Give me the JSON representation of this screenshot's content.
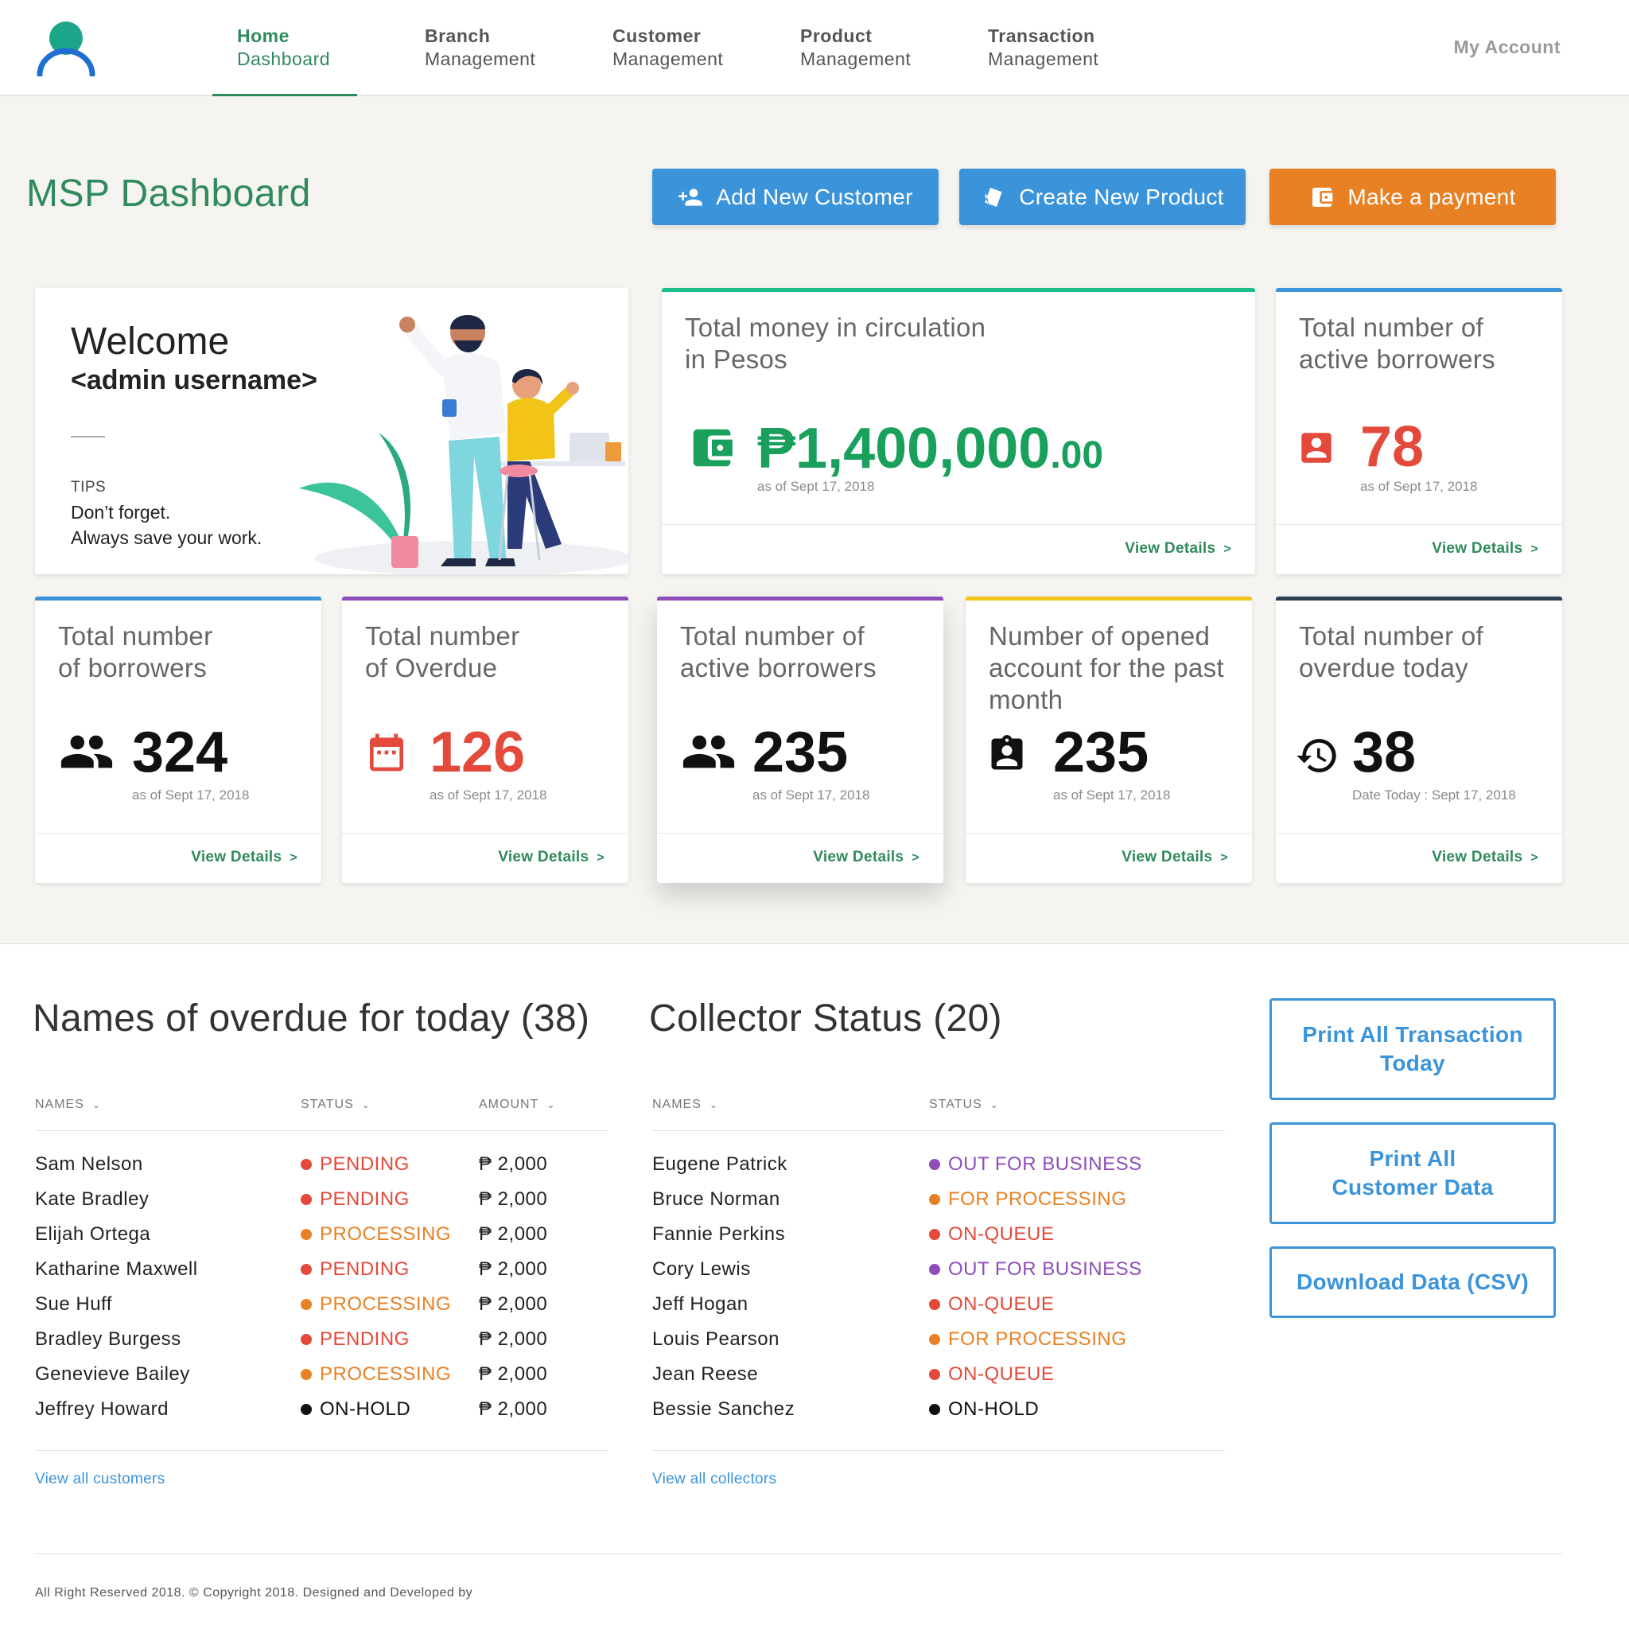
{
  "nav": {
    "items": [
      {
        "line1": "Home",
        "line2": "Dashboard"
      },
      {
        "line1": "Branch",
        "line2": "Management"
      },
      {
        "line1": "Customer",
        "line2": "Management"
      },
      {
        "line1": "Product",
        "line2": "Management"
      },
      {
        "line1": "Transaction",
        "line2": "Management"
      }
    ],
    "account": "My Account"
  },
  "header": {
    "title": "MSP Dashboard",
    "buttons": {
      "add_customer": "Add New Customer",
      "create_product": "Create New Product",
      "make_payment": "Make a payment"
    }
  },
  "welcome": {
    "greeting": "Welcome",
    "username": "<admin username>",
    "tips_label": "TIPS",
    "tips_line1": "Don’t forget.",
    "tips_line2": "Always save your work."
  },
  "cards": {
    "money": {
      "title_l1": "Total money in circulation",
      "title_l2": "in Pesos",
      "value": "₱1,400,000",
      "cents": ".00",
      "date": "as of Sept 17, 2018",
      "link": "View Details"
    },
    "active_top": {
      "title_l1": "Total number of",
      "title_l2": "active borrowers",
      "value": "78",
      "date": "as of Sept 17, 2018",
      "link": "View Details"
    },
    "borrowers": {
      "title_l1": "Total number",
      "title_l2": "of borrowers",
      "value": "324",
      "date": "as of Sept 17, 2018",
      "link": "View Details"
    },
    "overdue": {
      "title_l1": "Total number",
      "title_l2": "of Overdue",
      "value": "126",
      "date": "as of Sept 17, 2018",
      "link": "View Details"
    },
    "active": {
      "title_l1": "Total number of",
      "title_l2": "active borrowers",
      "value": "235",
      "date": "as of Sept 17, 2018",
      "link": "View Details"
    },
    "opened": {
      "title_l1": "Number of opened",
      "title_l2": "account for the past",
      "title_l3": "month",
      "value": "235",
      "date": "as of Sept 17, 2018",
      "link": "View Details"
    },
    "overdue_today": {
      "title_l1": "Total number of",
      "title_l2": "overdue today",
      "value": "38",
      "date": "Date Today : Sept 17, 2018",
      "link": "View Details"
    }
  },
  "overdue_table": {
    "title": "Names of overdue for today (38)",
    "headers": {
      "names": "NAMES",
      "status": "STATUS",
      "amount": "AMOUNT"
    },
    "rows": [
      {
        "name": "Sam Nelson",
        "status": "PENDING",
        "amount": "₱ 2,000"
      },
      {
        "name": "Kate Bradley",
        "status": "PENDING",
        "amount": "₱ 2,000"
      },
      {
        "name": "Elijah Ortega",
        "status": "PROCESSING",
        "amount": "₱ 2,000"
      },
      {
        "name": "Katharine Maxwell",
        "status": "PENDING",
        "amount": "₱ 2,000"
      },
      {
        "name": "Sue Huff",
        "status": "PROCESSING",
        "amount": "₱ 2,000"
      },
      {
        "name": "Bradley Burgess",
        "status": "PENDING",
        "amount": "₱ 2,000"
      },
      {
        "name": "Genevieve Bailey",
        "status": "PROCESSING",
        "amount": "₱ 2,000"
      },
      {
        "name": "Jeffrey Howard",
        "status": "ON-HOLD",
        "amount": "₱ 2,000"
      }
    ],
    "link": "View all customers"
  },
  "collector_table": {
    "title": "Collector Status (20)",
    "headers": {
      "names": "NAMES",
      "status": "STATUS"
    },
    "rows": [
      {
        "name": "Eugene Patrick",
        "status": "OUT FOR BUSINESS"
      },
      {
        "name": "Bruce Norman",
        "status": "FOR PROCESSING"
      },
      {
        "name": "Fannie Perkins",
        "status": "ON-QUEUE"
      },
      {
        "name": "Cory Lewis",
        "status": "OUT FOR BUSINESS"
      },
      {
        "name": "Jeff Hogan",
        "status": "ON-QUEUE"
      },
      {
        "name": "Louis Pearson",
        "status": "FOR PROCESSING"
      },
      {
        "name": "Jean Reese",
        "status": "ON-QUEUE"
      },
      {
        "name": "Bessie Sanchez",
        "status": "ON-HOLD"
      }
    ],
    "link": "View all collectors"
  },
  "actions": {
    "print_transactions_l1": "Print All Transaction",
    "print_transactions_l2": "Today",
    "print_customers_l1": "Print All",
    "print_customers_l2": "Customer Data",
    "download": "Download Data (CSV)"
  },
  "footer": "All Right Reserved 2018. © Copyright 2018. Designed and Developed by",
  "colors": {
    "brand_green": "#2f8a5c",
    "blue": "#3b94da",
    "orange": "#e88124",
    "red": "#e34a3b",
    "purple": "#8e4dbb",
    "black": "#111111"
  },
  "icons": {
    "add_customer": "person-add-icon",
    "create_product": "tag-icon",
    "make_payment": "wallet-icon",
    "money": "wallet-icon",
    "active_top": "account-box-icon",
    "borrowers": "people-icon",
    "overdue": "calendar-icon",
    "active": "people-icon",
    "opened": "badge-icon",
    "overdue_today": "history-icon"
  }
}
